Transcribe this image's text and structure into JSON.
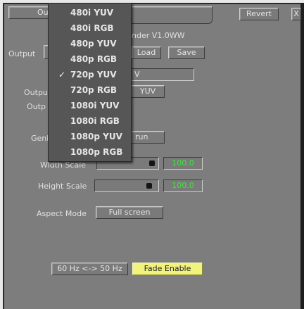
{
  "toolbar": {
    "top_left_label": "Ou",
    "revert_label": "Revert",
    "close_label": "X"
  },
  "panel": {
    "version_text": "nder V1.0WW",
    "output_label": "Output",
    "load_label": "Load",
    "save_label": "Save",
    "format_field_value": "V",
    "output_label_2": "Outpu",
    "output_label_3": "Outp",
    "color_value": "YUV",
    "genlock_label": "Genl",
    "genlock_value": "run",
    "width_scale_label": "Width Scale",
    "width_scale_value": "100.0",
    "height_scale_label": "Height Scale",
    "height_scale_value": "100.0",
    "aspect_mode_label": "Aspect Mode",
    "aspect_mode_value": "Full screen",
    "hz_button_label": "60 Hz <-> 50 Hz",
    "fade_enable_label": "Fade Enable"
  },
  "menu": {
    "items": [
      {
        "label": "480i YUV",
        "checked": ""
      },
      {
        "label": "480i RGB",
        "checked": ""
      },
      {
        "label": "480p YUV",
        "checked": ""
      },
      {
        "label": "480p RGB",
        "checked": ""
      },
      {
        "label": "720p YUV",
        "checked": "✓"
      },
      {
        "label": "720p RGB",
        "checked": ""
      },
      {
        "label": "1080i YUV",
        "checked": ""
      },
      {
        "label": "1080i RGB",
        "checked": ""
      },
      {
        "label": "1080p YUV",
        "checked": ""
      },
      {
        "label": "1080p RGB",
        "checked": ""
      }
    ]
  }
}
